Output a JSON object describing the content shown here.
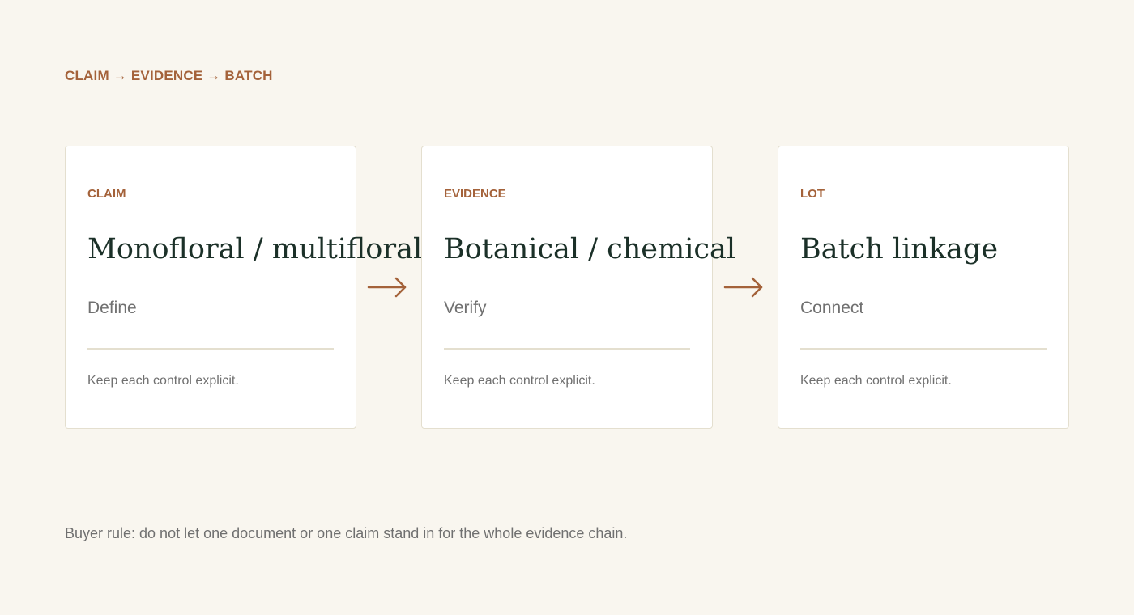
{
  "header": {
    "title": "CLAIM → EVIDENCE → BATCH"
  },
  "cards": [
    {
      "tag": "CLAIM",
      "title": "Monofloral / multifloral",
      "verb": "Define",
      "note": "Keep each control explicit."
    },
    {
      "tag": "EVIDENCE",
      "title": "Botanical / chemical",
      "verb": "Verify",
      "note": "Keep each control explicit."
    },
    {
      "tag": "LOT",
      "title": "Batch linkage",
      "verb": "Connect",
      "note": "Keep each control explicit."
    }
  ],
  "connectors": [
    {
      "icon": "arrow-right-icon"
    },
    {
      "icon": "arrow-right-icon"
    }
  ],
  "footer": {
    "text": "Buyer rule: do not let one document or one claim stand in for the whole evidence chain."
  },
  "colors": {
    "background": "#f9f6ef",
    "accent": "#a4623a",
    "title_text": "#1b3028",
    "muted_text": "#707070",
    "card_border": "#e4dfcf"
  }
}
